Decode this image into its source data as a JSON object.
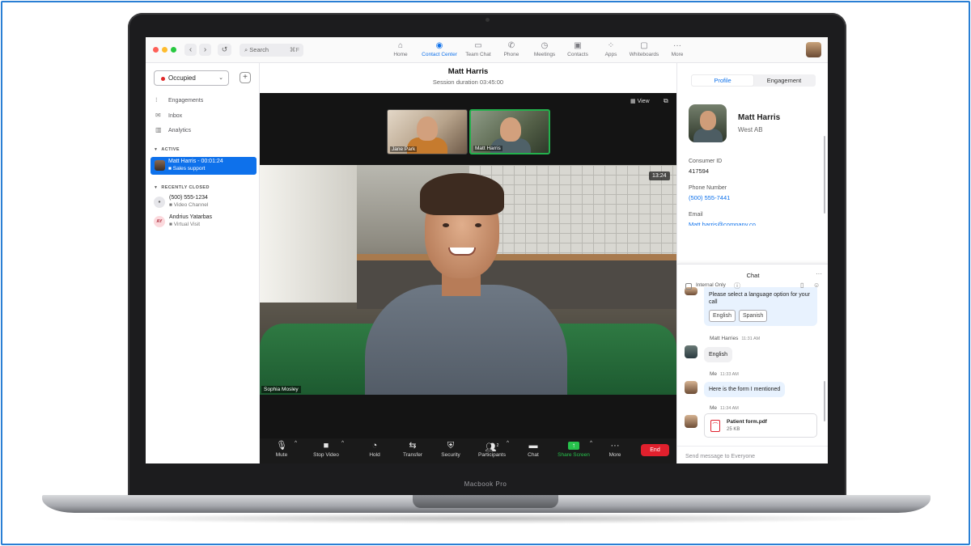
{
  "colors": {
    "accent": "#0e71eb",
    "end": "#e0202d",
    "busy": "#e02828",
    "share": "#27c24c"
  },
  "device": {
    "label": "Macbook Pro"
  },
  "topbar": {
    "search_placeholder": "Search",
    "search_shortcut": "⌘F",
    "tabs": [
      {
        "label": "Home",
        "icon": "home-icon"
      },
      {
        "label": "Contact Center",
        "icon": "contact-center-icon"
      },
      {
        "label": "Team Chat",
        "icon": "team-chat-icon"
      },
      {
        "label": "Phone",
        "icon": "phone-icon"
      },
      {
        "label": "Meetings",
        "icon": "meetings-icon"
      },
      {
        "label": "Contacts",
        "icon": "contacts-icon"
      },
      {
        "label": "Apps",
        "icon": "apps-icon"
      },
      {
        "label": "Whiteboards",
        "icon": "whiteboards-icon"
      },
      {
        "label": "More",
        "icon": "more-icon"
      }
    ],
    "active_tab": "Contact Center"
  },
  "sidebar": {
    "status": "Occupied",
    "links": [
      "Engagements",
      "Inbox",
      "Analytics"
    ],
    "active_header": "ACTIVE",
    "active_item": {
      "name": "Matt Harris - 00:01:24",
      "sub": "Sales support"
    },
    "closed_header": "RECENTLY CLOSED",
    "closed_items": [
      {
        "name": "(500) 555-1234",
        "sub": "Video Channel",
        "initials": ""
      },
      {
        "name": "Andrius Yatarbas",
        "sub": "Virtual Visit",
        "initials": "AY"
      }
    ]
  },
  "meeting": {
    "title": "Matt Harris",
    "duration": "Session duration 03:45:00",
    "view_label": "View",
    "thumbnails": [
      "Jane Park",
      "Matt Harris"
    ],
    "timer": "13:24",
    "speaker_name": "Sophia Mosley",
    "controls": [
      {
        "label": "Mute",
        "icon": "microphone-icon"
      },
      {
        "label": "Stop Video",
        "icon": "video-camera-icon"
      },
      {
        "label": "Hold",
        "icon": "hold-icon"
      },
      {
        "label": "Transfer",
        "icon": "transfer-icon"
      },
      {
        "label": "Security",
        "icon": "shield-icon"
      },
      {
        "label": "Participants",
        "icon": "participants-icon",
        "count": "2"
      },
      {
        "label": "Chat",
        "icon": "chat-icon"
      },
      {
        "label": "Share Screen",
        "icon": "share-screen-icon"
      },
      {
        "label": "More",
        "icon": "more-icon"
      }
    ],
    "end_label": "End"
  },
  "profile": {
    "tabs": [
      "Profile",
      "Engagement"
    ],
    "name": "Matt Harris",
    "company": "West AB",
    "consumer_id_label": "Consumer ID",
    "consumer_id": "417594",
    "phone_label": "Phone Number",
    "phone": "(500) 555-7441",
    "email_label": "Email",
    "email": "Matt.harris@company.co"
  },
  "chat": {
    "title": "Chat",
    "prompt": "Please select a language option for your call",
    "options": [
      "English",
      "Spanish"
    ],
    "msg1_sender": "Matt Harries",
    "msg1_time": "11:31 AM",
    "msg1_text": "English",
    "msg2_sender": "Me",
    "msg2_time": "11:33 AM",
    "msg2_text": "Here is the form I mentioned",
    "msg3_sender": "Me",
    "msg3_time": "11:34 AM",
    "file_name": "Patient form.pdf",
    "file_size": "25 KB",
    "input_placeholder": "Send message to Everyone",
    "internal_label": "Internal Only"
  }
}
